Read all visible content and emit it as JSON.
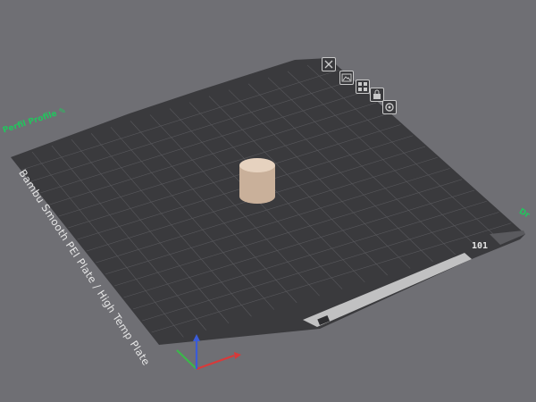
{
  "viewport": {
    "background": "#6f6f74",
    "bed_color": "#3a3a3d",
    "grid_color": "#5e5e62",
    "accent_color": "#22c55e"
  },
  "bed": {
    "plate_name": "Bambu Smooth PEI Plate / High Temp Plate",
    "label_left": "Perfil Profile",
    "label_right": "Dr",
    "plate_index": "101"
  },
  "plate_toolbar": [
    {
      "name": "remove-plate-icon"
    },
    {
      "name": "image-icon"
    },
    {
      "name": "arrange-icon"
    },
    {
      "name": "lock-icon"
    },
    {
      "name": "settings-icon"
    }
  ],
  "object": {
    "shape": "cylinder",
    "color": "#e0c9b4"
  },
  "axes": {
    "x_color": "#d83a3a",
    "y_color": "#3bb84a",
    "z_color": "#3a5cd8"
  }
}
